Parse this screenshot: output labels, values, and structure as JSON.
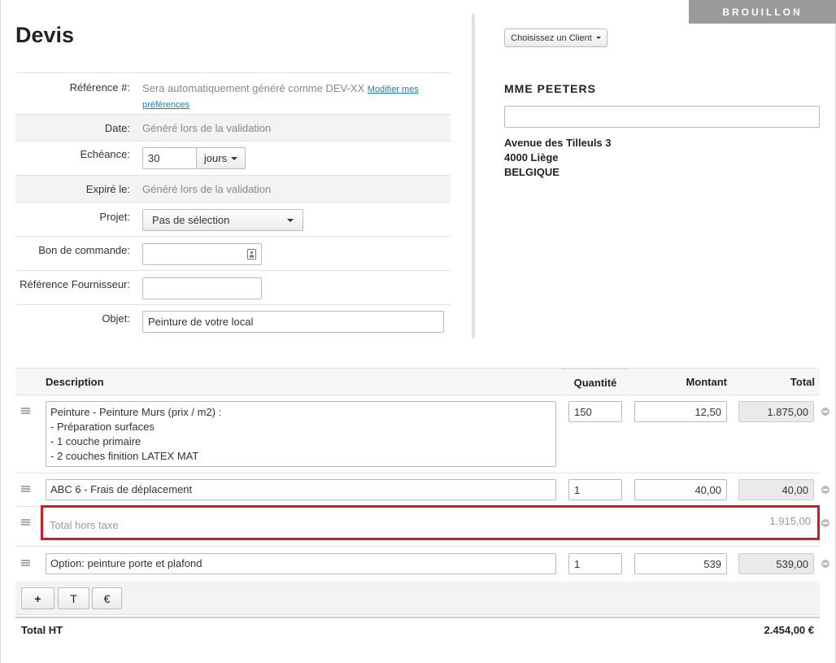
{
  "status": "BROUILLON",
  "title": "Devis",
  "form": {
    "reference": {
      "label": "Référence #:",
      "value": "Sera automatiquement généré comme DEV-XX",
      "link1": "Modifier mes",
      "link2": "préférences"
    },
    "date": {
      "label": "Date:",
      "value": "Généré lors de la validation"
    },
    "echeance": {
      "label": "Echéance:",
      "value": "30",
      "unit": "jours"
    },
    "expire": {
      "label": "Expiré le:",
      "value": "Généré lors de la validation"
    },
    "projet": {
      "label": "Projet:",
      "value": "Pas de sélection"
    },
    "bon_commande": {
      "label": "Bon de commande:",
      "value": ""
    },
    "ref_fournisseur": {
      "label": "Référence Fournisseur:",
      "value": ""
    },
    "objet": {
      "label": "Objet:",
      "value": "Peinture de votre local"
    }
  },
  "client": {
    "choose_label": "Choisissez un Client",
    "name": "MME PEETERS",
    "address_line1": "Avenue des Tilleuls 3",
    "address_line2": "4000 Liège",
    "address_line3": "BELGIQUE"
  },
  "table": {
    "headers": {
      "description": "Description",
      "quantity": "Quantité",
      "amount": "Montant",
      "total": "Total"
    },
    "lines": [
      {
        "description": [
          "Peinture - Peinture Murs (prix / m2) :",
          "- Préparation surfaces",
          "- 1 couche primaire",
          "- 2 couches finition LATEX MAT"
        ],
        "quantity": "150",
        "amount": "12,50",
        "total": "1.875,00"
      },
      {
        "description": [
          "ABC 6 - Frais de déplacement"
        ],
        "quantity": "1",
        "amount": "40,00",
        "total": "40,00"
      },
      {
        "description": [
          "Option: peinture porte et plafond"
        ],
        "quantity": "1",
        "amount": "539",
        "total": "539,00"
      }
    ],
    "subtotal": {
      "label": "Total hors taxe",
      "value": "1.915,00"
    }
  },
  "toolbar": {
    "add": "+",
    "text": "T",
    "euro": "€"
  },
  "totals": {
    "label": "Total HT",
    "value": "2.454,00 €"
  },
  "colors": {
    "highlight": "#e0161e",
    "ribbon": "#9b9b9b",
    "link": "#1a7fc1"
  }
}
